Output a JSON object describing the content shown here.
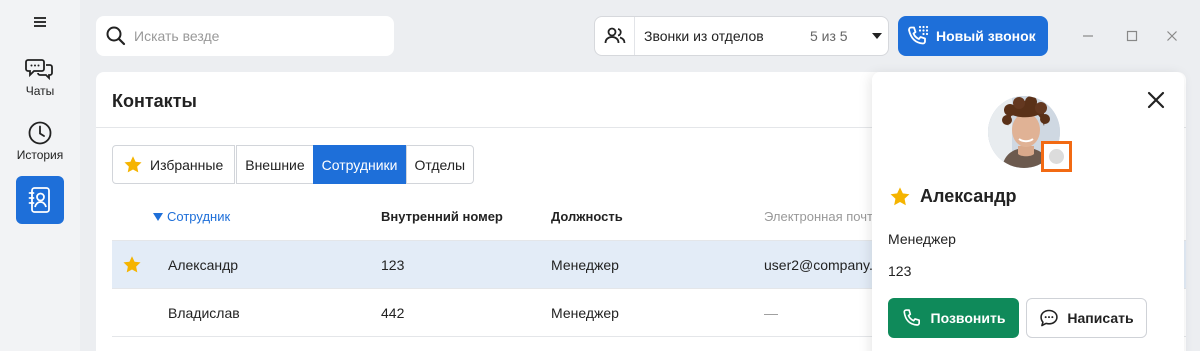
{
  "sidebar": {
    "menu_icon": "hamburger-icon",
    "items": [
      {
        "label": "Чаты",
        "icon": "chats-icon"
      },
      {
        "label": "История",
        "icon": "clock-icon"
      },
      {
        "label": "",
        "icon": "contacts-icon",
        "active": true
      }
    ]
  },
  "topbar": {
    "search_placeholder": "Искать везде",
    "dept_label": "Звонки из отделов",
    "dept_count": "5 из 5",
    "new_call_label": "Новый звонок"
  },
  "contacts": {
    "title": "Контакты",
    "tabs": [
      {
        "label": "Избранные",
        "icon": "star-icon",
        "active": false
      },
      {
        "label": "Внешние",
        "active": false
      },
      {
        "label": "Сотрудники",
        "active": true
      },
      {
        "label": "Отделы",
        "active": false
      }
    ],
    "columns": [
      "Сотрудник",
      "Внутренний номер",
      "Должность",
      "Электронная почта"
    ],
    "rows": [
      {
        "favorite": true,
        "name": "Александр",
        "ext": "123",
        "position": "Менеджер",
        "email": "user2@company.",
        "selected": true
      },
      {
        "favorite": false,
        "name": "Владислав",
        "ext": "442",
        "position": "Менеджер",
        "email": "—",
        "selected": false
      }
    ]
  },
  "card": {
    "name": "Александр",
    "position": "Менеджер",
    "ext": "123",
    "call_label": "Позвонить",
    "message_label": "Написать"
  },
  "colors": {
    "accent": "#1e6fd9",
    "call_green": "#0f8a5a",
    "star": "#f5b400",
    "highlight": "#f26a13"
  }
}
